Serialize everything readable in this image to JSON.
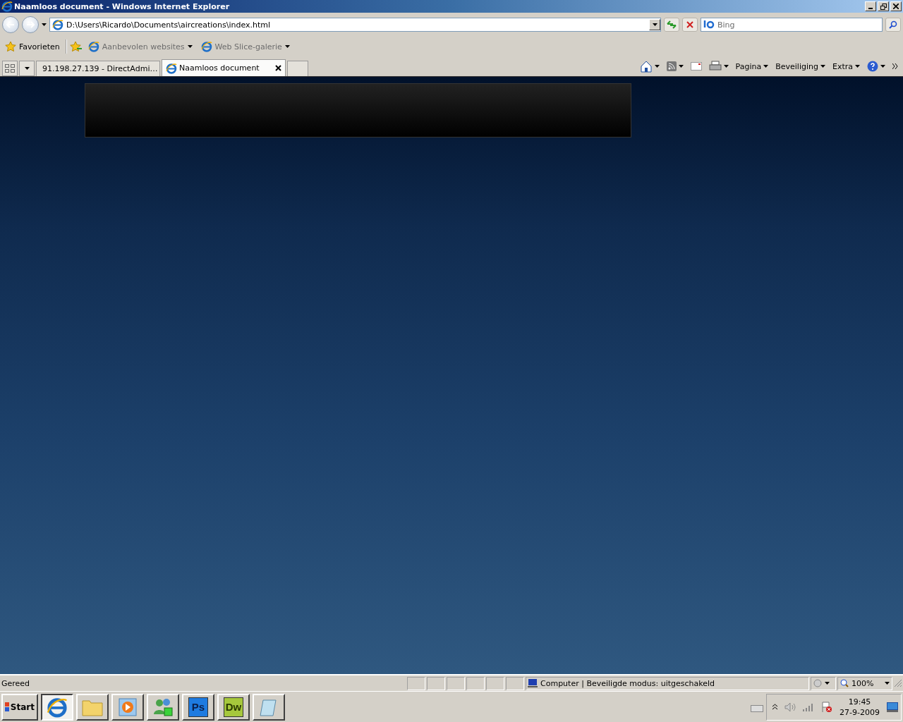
{
  "window": {
    "title": "Naamloos document - Windows Internet Explorer"
  },
  "address_bar": {
    "value": "D:\\Users\\Ricardo\\Documents\\aircreations\\index.html"
  },
  "search": {
    "placeholder": "Bing"
  },
  "favorites_bar": {
    "label": "Favorieten",
    "items": [
      {
        "label": "Aanbevolen websites"
      },
      {
        "label": "Web Slice-galerie"
      }
    ]
  },
  "tabs": [
    {
      "label": "91.198.27.139 - DirectAdmi…",
      "selected": false
    },
    {
      "label": "Naamloos document",
      "selected": true
    }
  ],
  "command_bar": {
    "menus": [
      "Pagina",
      "Beveiliging",
      "Extra"
    ]
  },
  "status_bar": {
    "status": "Gereed",
    "zone": "Computer | Beveiligde modus: uitgeschakeld",
    "zoom": "100%"
  },
  "taskbar": {
    "start": "Start",
    "apps": [
      {
        "kind": "ie",
        "selected": true
      },
      {
        "kind": "explorer",
        "selected": false
      },
      {
        "kind": "media",
        "selected": false
      },
      {
        "kind": "messenger",
        "selected": false
      },
      {
        "kind": "photoshop",
        "selected": false,
        "label": "Ps"
      },
      {
        "kind": "dreamweaver",
        "selected": false,
        "label": "Dw"
      },
      {
        "kind": "notepad",
        "selected": false
      }
    ],
    "clock": {
      "time": "19:45",
      "date": "27-9-2009"
    }
  }
}
